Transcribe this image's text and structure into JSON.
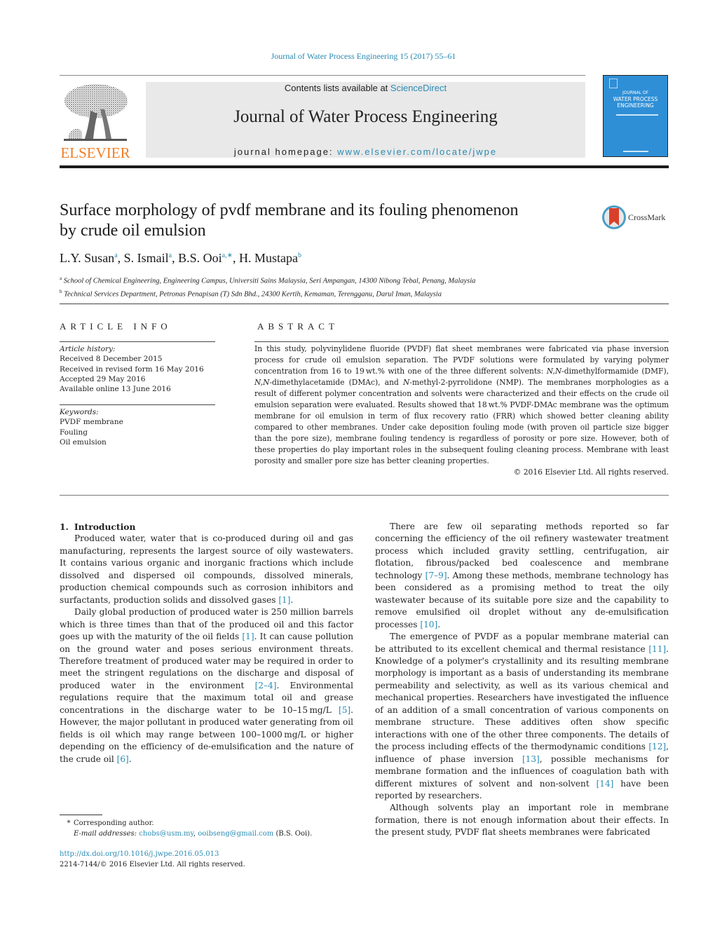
{
  "running_head": "Journal of Water Process Engineering 15 (2017) 55–61",
  "masthead": {
    "publisher_logo_text": "ELSEVIER",
    "contents_prefix": "Contents lists available at ",
    "contents_link": "ScienceDirect",
    "journal_name": "Journal of Water Process Engineering",
    "homepage_prefix": "journal homepage: ",
    "homepage_link": "www.elsevier.com/locate/jwpe",
    "cover": {
      "line1": "JOURNAL OF",
      "line2": "WATER PROCESS",
      "line3": "ENGINEERING",
      "color": "#2f8fd6"
    }
  },
  "colors": {
    "link": "#2a8bb3",
    "elsevier_orange": "#f07e26",
    "crossmark_red": "#d9402b"
  },
  "article": {
    "title_line1": "Surface morphology of pvdf membrane and its fouling phenomenon",
    "title_line2": "by crude oil emulsion",
    "crossmark_label": "CrossMark",
    "authors": [
      {
        "name": "L.Y. Susan",
        "sup": "a"
      },
      {
        "name": "S. Ismail",
        "sup": "a"
      },
      {
        "name": "B.S. Ooi",
        "sup": "a,∗"
      },
      {
        "name": "H. Mustapa",
        "sup": "b"
      }
    ],
    "affiliations": [
      {
        "sup": "a",
        "text": "School of Chemical Engineering, Engineering Campus, Universiti Sains Malaysia, Seri Ampangan, 14300 Nibong Tebal, Penang, Malaysia"
      },
      {
        "sup": "b",
        "text": "Technical Services Department, Petronas Penapisan (T) Sdn Bhd., 24300 Kertih, Kemaman, Terengganu, Darul Iman, Malaysia"
      }
    ]
  },
  "article_info": {
    "heading": "ARTICLE INFO",
    "history_label": "Article history:",
    "history": [
      "Received 8 December 2015",
      "Received in revised form 16 May 2016",
      "Accepted 29 May 2016",
      "Available online 13 June 2016"
    ],
    "keywords_label": "Keywords:",
    "keywords": [
      "PVDF membrane",
      "Fouling",
      "Oil emulsion"
    ]
  },
  "abstract": {
    "heading": "ABSTRACT",
    "parts": [
      "In this study, polyvinylidene fluoride (PVDF) flat sheet membranes were fabricated via phase inversion process for crude oil emulsion separation. The PVDF solutions were formulated by varying polymer concentration from 16 to 19 wt.% with one of the three different solvents: ",
      "N,N",
      "-dimethylformamide (DMF), ",
      "N,N",
      "-dimethylacetamide (DMAc), and ",
      "N",
      "-methyl-2-pyrrolidone (NMP). The membranes morphologies as a result of different polymer concentration and solvents were characterized and their effects on the crude oil emulsion separation were evaluated. Results showed that 18 wt.% PVDF-DMAc membrane was the optimum membrane for oil emulsion in term of flux recovery ratio (FRR) which showed better cleaning ability compared to other membranes. Under cake deposition fouling mode (with proven oil particle size bigger than the pore size), membrane fouling tendency is regardless of porosity or pore size. However, both of these properties do play important roles in the subsequent fouling cleaning process. Membrane with least porosity and smaller pore size has better cleaning properties."
    ],
    "copyright": "© 2016 Elsevier Ltd. All rights reserved."
  },
  "introduction": {
    "section_number": "1.",
    "section_title": "Introduction",
    "left": {
      "p1": "Produced water, water that is co-produced during oil and gas manufacturing, represents the largest source of oily wastewaters. It contains various organic and inorganic fractions which include dissolved and dispersed oil compounds, dissolved minerals, production chemical compounds such as corrosion inhibitors and surfactants, production solids and dissolved gases ",
      "p1_ref": "[1]",
      "p1_end": ".",
      "p2_a": "Daily global production of produced water is 250 million barrels which is three times than that of the produced oil and this factor goes up with the maturity of the oil fields ",
      "p2_ref1": "[1]",
      "p2_b": ". It can cause pollution on the ground water and poses serious environment threats. Therefore treatment of produced water may be required in order to meet the stringent regulations on the discharge and disposal of produced water in the environment ",
      "p2_ref2": "[2–4]",
      "p2_c": ". Environmental regulations require that the maximum total oil and grease concentrations in the discharge water to be 10–15 mg/L ",
      "p2_ref3": "[5]",
      "p2_d": ". However, the major pollutant in produced water generating from oil fields is oil which may range between 100–1000 mg/L or higher depending on the efficiency of de-emulsification and the nature of the crude oil ",
      "p2_ref4": "[6]",
      "p2_e": "."
    },
    "right": {
      "p1_a": "There are few oil separating methods reported so far concerning the efficiency of the oil refinery wastewater treatment process which included gravity settling, centrifugation, air flotation, fibrous/packed bed coalescence and membrane technology ",
      "p1_ref1": "[7–9]",
      "p1_b": ". Among these methods, membrane technology has been considered as a promising method to treat the oily wastewater because of its suitable pore size and the capability to remove emulsified oil droplet without any de-emulsification processes ",
      "p1_ref2": "[10]",
      "p1_c": ".",
      "p2_a": "The emergence of PVDF as a popular membrane material can be attributed to its excellent chemical and thermal resistance ",
      "p2_ref1": "[11]",
      "p2_b": ". Knowledge of a polymer's crystallinity and its resulting membrane morphology is important as a basis of understanding its membrane permeability and selectivity, as well as its various chemical and mechanical properties. Researchers have investigated the influence of an addition of a small concentration of various components on membrane structure. These additives often show specific interactions with one of the other three components. The details of the process including effects of the thermodynamic conditions ",
      "p2_ref2": "[12]",
      "p2_c": ", influence of phase inversion ",
      "p2_ref3": "[13]",
      "p2_d": ", possible mechanisms for membrane formation and the influences of coagulation bath with different mixtures of solvent and non-solvent ",
      "p2_ref4": "[14]",
      "p2_e": " have been reported by researchers.",
      "p3": "Although solvents play an important role in membrane formation, there is not enough information about their effects. In the present study, PVDF flat sheets membranes were fabricated"
    }
  },
  "footnote": {
    "marker": "*",
    "corresponding": "Corresponding author.",
    "email_label": "E-mail addresses:",
    "email1": "chobs@usm.my",
    "email2": "ooibseng@gmail.com",
    "email_suffix": " (B.S. Ooi)."
  },
  "doi": {
    "url": "http://dx.doi.org/10.1016/j.jwpe.2016.05.013",
    "issn_line": "2214-7144/© 2016 Elsevier Ltd. All rights reserved."
  }
}
